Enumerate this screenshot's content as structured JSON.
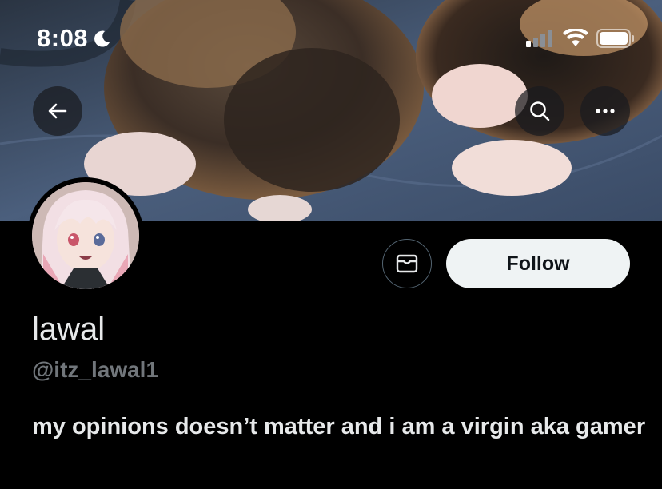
{
  "status_bar": {
    "time": "8:08",
    "moon_icon": "moon-icon",
    "signal_icon": "cellular-signal-icon",
    "wifi_icon": "wifi-icon",
    "battery_icon": "battery-icon"
  },
  "banner": {
    "image": "calico-kittens-on-jeans",
    "back_icon": "arrow-left-icon",
    "search_icon": "search-icon",
    "more_icon": "more-horizontal-icon"
  },
  "profile": {
    "avatar": "anime-girl-avatar",
    "message_icon": "envelope-icon",
    "follow_label": "Follow",
    "display_name": "lawal",
    "handle": "@itz_lawal1",
    "bio": "my opinions doesn’t matter and i am a virgin aka gamer"
  },
  "colors": {
    "background": "#000000",
    "primary_text": "#e7e9ea",
    "secondary_text": "#71767b",
    "follow_bg": "#eff3f4"
  }
}
